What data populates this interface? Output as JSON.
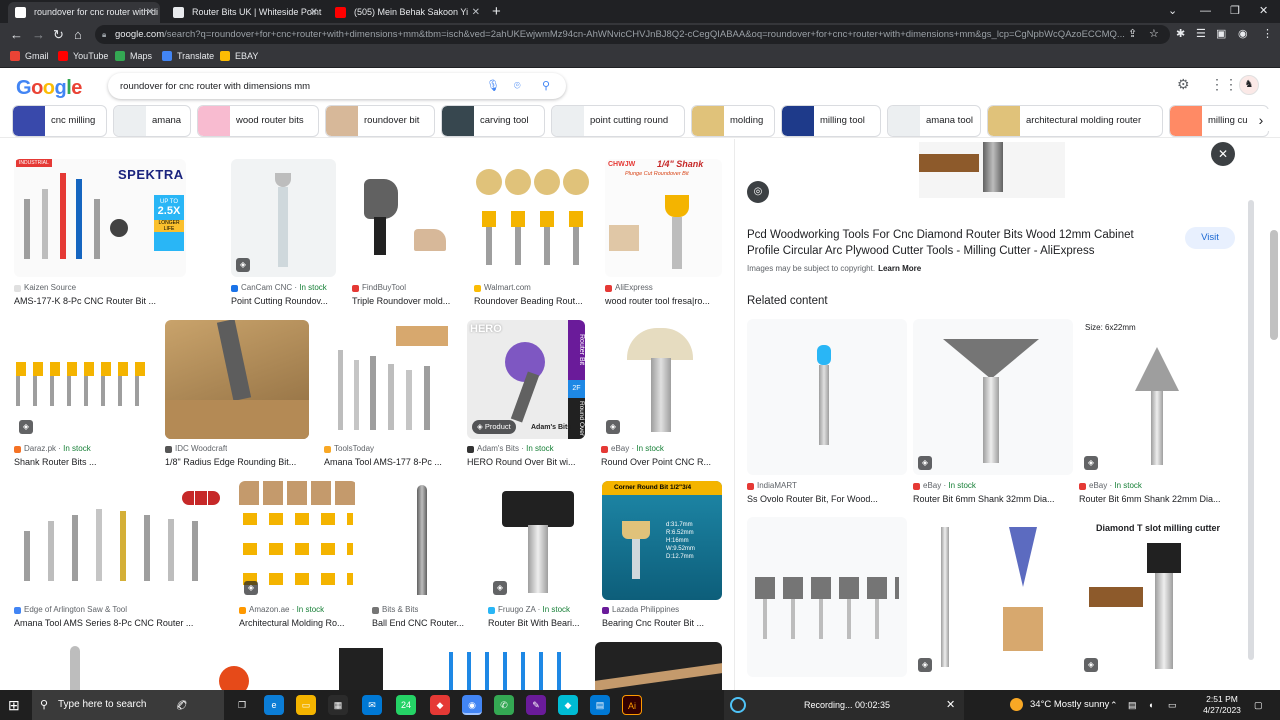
{
  "tabs": [
    {
      "title": "roundover for cnc router with di",
      "favicon_color": "#ffffff"
    },
    {
      "title": "Router Bits UK | Whiteside Point",
      "favicon_color": "#e8eaed"
    },
    {
      "title": "(505) Mein Behak Sakoon Yi",
      "favicon_color": "#ff0000"
    }
  ],
  "address_bar": {
    "host": "google.com",
    "path": "/search?q=roundover+for+cnc+router+with+dimensions+mm&tbm=isch&ved=2ahUKEwjwmMz94cn-AhWNvicCHVJnBJ8Q2-cCegQIABAA&oq=roundover+for+cnc+router+with+dimensions+mm&gs_lcp=CgNpbWcQAzoECCMQ..."
  },
  "bookmarks": [
    {
      "label": "Gmail",
      "color": "#ea4335"
    },
    {
      "label": "YouTube",
      "color": "#ff0000"
    },
    {
      "label": "Maps",
      "color": "#34a853"
    },
    {
      "label": "Translate",
      "color": "#4285f4"
    },
    {
      "label": "EBAY",
      "color": "#fbbc04"
    }
  ],
  "search": {
    "query": "roundover for cnc router with dimensions mm"
  },
  "chips": [
    "cnc milling",
    "amana",
    "wood router bits",
    "roundover bit",
    "carving tool",
    "point cutting round",
    "molding",
    "milling tool",
    "amana tool",
    "architectural molding router",
    "milling cu"
  ],
  "results": [
    {
      "source": "Kaizen Source",
      "stock": "",
      "title": "AMS-177-K 8-Pc CNC Router Bit ...",
      "dot": "#e0e0e0",
      "banner": "SPEKTRA",
      "banner2": "UP TO",
      "banner3": "2.5X",
      "banner4": "LONGER LIFE"
    },
    {
      "source": "CanCam CNC",
      "stock": "In stock",
      "title": "Point Cutting Roundov...",
      "dot": "#1a73e8"
    },
    {
      "source": "FindBuyTool",
      "stock": "",
      "title": "Triple Roundover mold...",
      "dot": "#e53935"
    },
    {
      "source": "Walmart.com",
      "stock": "",
      "title": "Roundover Beading Rout...",
      "dot": "#fbbc04"
    },
    {
      "source": "AliExpress",
      "stock": "",
      "title": "wood router tool fresa|ro...",
      "dot": "#e53935",
      "banner": "CHWJW",
      "banner2": "1/4\" Shank",
      "banner3": "Plunge Cut Roundover Bit"
    },
    {
      "source": "Daraz.pk",
      "stock": "In stock",
      "title": "Shank Router Bits ...",
      "dot": "#f57224"
    },
    {
      "source": "IDC Woodcraft",
      "stock": "",
      "title": "1/8\" Radius Edge Rounding Bit...",
      "dot": "#555555"
    },
    {
      "source": "ToolsToday",
      "stock": "",
      "title": "Amana Tool AMS-177 8-Pc ...",
      "dot": "#f9a825"
    },
    {
      "source": "Adam's Bits",
      "stock": "In stock",
      "title": "HERO Round Over Bit wi...",
      "dot": "#333333",
      "badge": "Product",
      "side1": "Router Bit",
      "side2": "2F",
      "side3": "Round Over",
      "corner": "HERO",
      "brand": "Adam's Bits"
    },
    {
      "source": "eBay",
      "stock": "In stock",
      "title": "Round Over Point CNC R...",
      "dot": "#e53935"
    },
    {
      "source": "Edge of Arlington Saw & Tool",
      "stock": "",
      "title": "Amana Tool AMS Series 8-Pc CNC Router ...",
      "dot": "#4285f4"
    },
    {
      "source": "Amazon.ae",
      "stock": "In stock",
      "title": "Architectural Molding Ro...",
      "dot": "#ff9900"
    },
    {
      "source": "Bits & Bits",
      "stock": "",
      "title": "Ball End CNC Router...",
      "dot": "#757575"
    },
    {
      "source": "Fruugo ZA",
      "stock": "In stock",
      "title": "Router Bit With Beari...",
      "dot": "#29b6f6"
    },
    {
      "source": "Lazada Philippines",
      "stock": "",
      "title": "Bearing Cnc Router Bit ...",
      "dot": "#6a1b9a",
      "banner": "Corner Round Bit  1/2\"3/4"
    }
  ],
  "panel": {
    "title": "Pcd Woodworking Tools For Cnc Diamond Router Bits Wood 12mm Cabinet Profile Circular Arc Plywood Cutter Tools - Milling Cutter - AliExpress",
    "visit_label": "Visit",
    "copyright": "Images may be subject to copyright.",
    "learn_more": "Learn More",
    "related_heading": "Related content",
    "related": [
      {
        "source": "IndiaMART",
        "stock": "",
        "title": "Ss Ovolo Router Bit, For Wood...",
        "dot": "#e53935",
        "label": ""
      },
      {
        "source": "eBay",
        "stock": "In stock",
        "title": "Router Bit 6mm Shank 32mm Dia...",
        "dot": "#e53935",
        "label": ""
      },
      {
        "source": "eBay",
        "stock": "In stock",
        "title": "Router Bit 6mm Shank 22mm Dia...",
        "dot": "#e53935",
        "label": "Size:  6x22mm"
      },
      {
        "source": "",
        "stock": "",
        "title": "",
        "dot": "#ffffff",
        "label": ""
      },
      {
        "source": "",
        "stock": "",
        "title": "",
        "dot": "#ffffff",
        "label": ""
      },
      {
        "source": "",
        "stock": "",
        "title": "",
        "dot": "#ffffff",
        "label": "Diamond T slot milling cutter"
      }
    ]
  },
  "taskbar": {
    "search_placeholder": "Type here to search",
    "recording_text": "Recording... 00:02:35",
    "weather": "34°C  Mostly sunny",
    "time": "2:51 PM",
    "date": "4/27/2023",
    "whatsapp_badge": "24"
  },
  "colors": {
    "accent_blue": "#1a73e8",
    "in_stock_green": "#188038",
    "chrome_dark": "#202124",
    "chrome_toolbar": "#35363a"
  }
}
